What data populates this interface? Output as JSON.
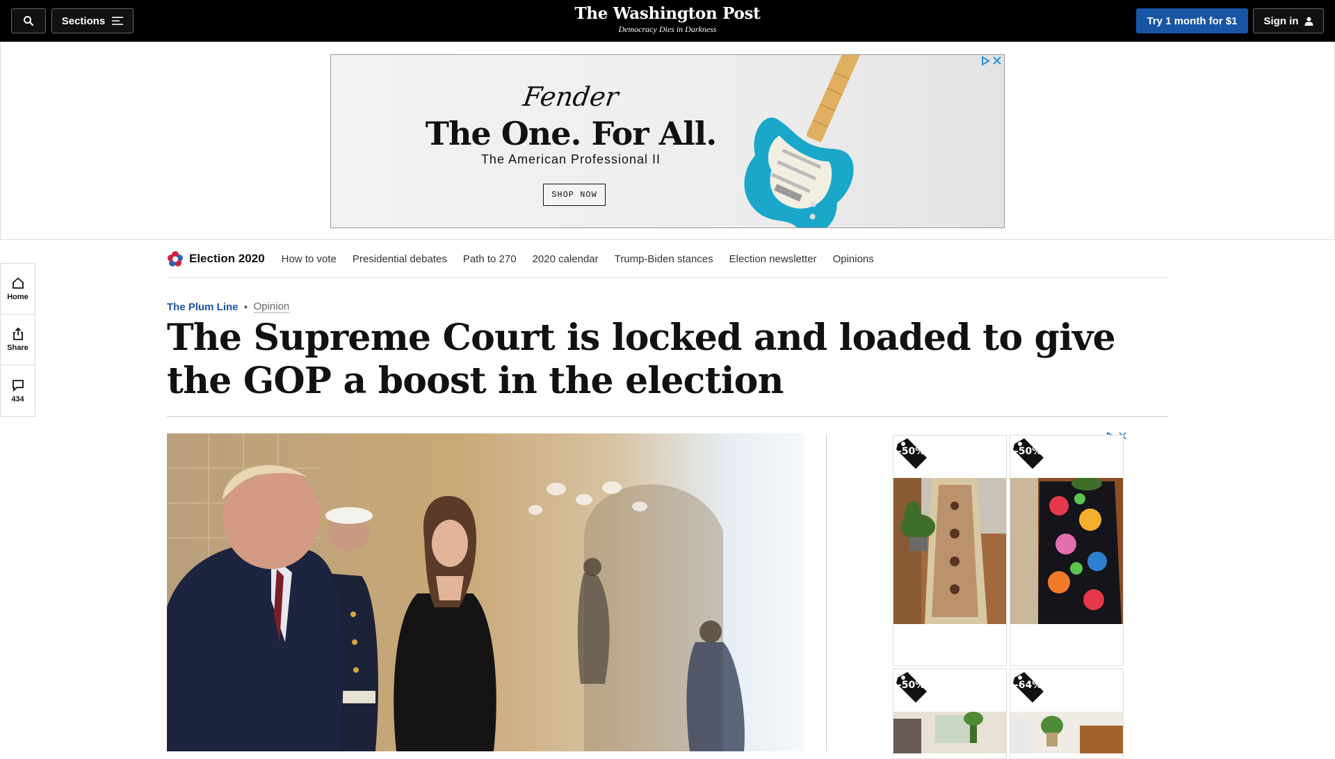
{
  "header": {
    "sections_label": "Sections",
    "logo": "The Washington Post",
    "tagline": "Democracy Dies in Darkness",
    "subscribe_label": "Try 1 month for $1",
    "signin_label": "Sign in"
  },
  "ad_banner": {
    "brand": "Fender",
    "headline": "The One. For All.",
    "subline": "The American Professional II",
    "cta": "SHOP NOW",
    "guitar_color": "#1aa7c9"
  },
  "rail": {
    "home_label": "Home",
    "share_label": "Share",
    "comments_count": "434"
  },
  "election_nav": {
    "brand": "Election 2020",
    "links": [
      "How to vote",
      "Presidential debates",
      "Path to 270",
      "2020 calendar",
      "Trump-Biden stances",
      "Election newsletter",
      "Opinions"
    ]
  },
  "article": {
    "section": "The Plum Line",
    "type": "Opinion",
    "headline": "The Supreme Court is locked and loaded to give the GOP a boost in the election"
  },
  "side_ad": {
    "badges": [
      "-50%",
      "-50%",
      "-50%",
      "-64%"
    ]
  },
  "colors": {
    "accent_blue": "#1955a5",
    "topbar": "#000000"
  }
}
